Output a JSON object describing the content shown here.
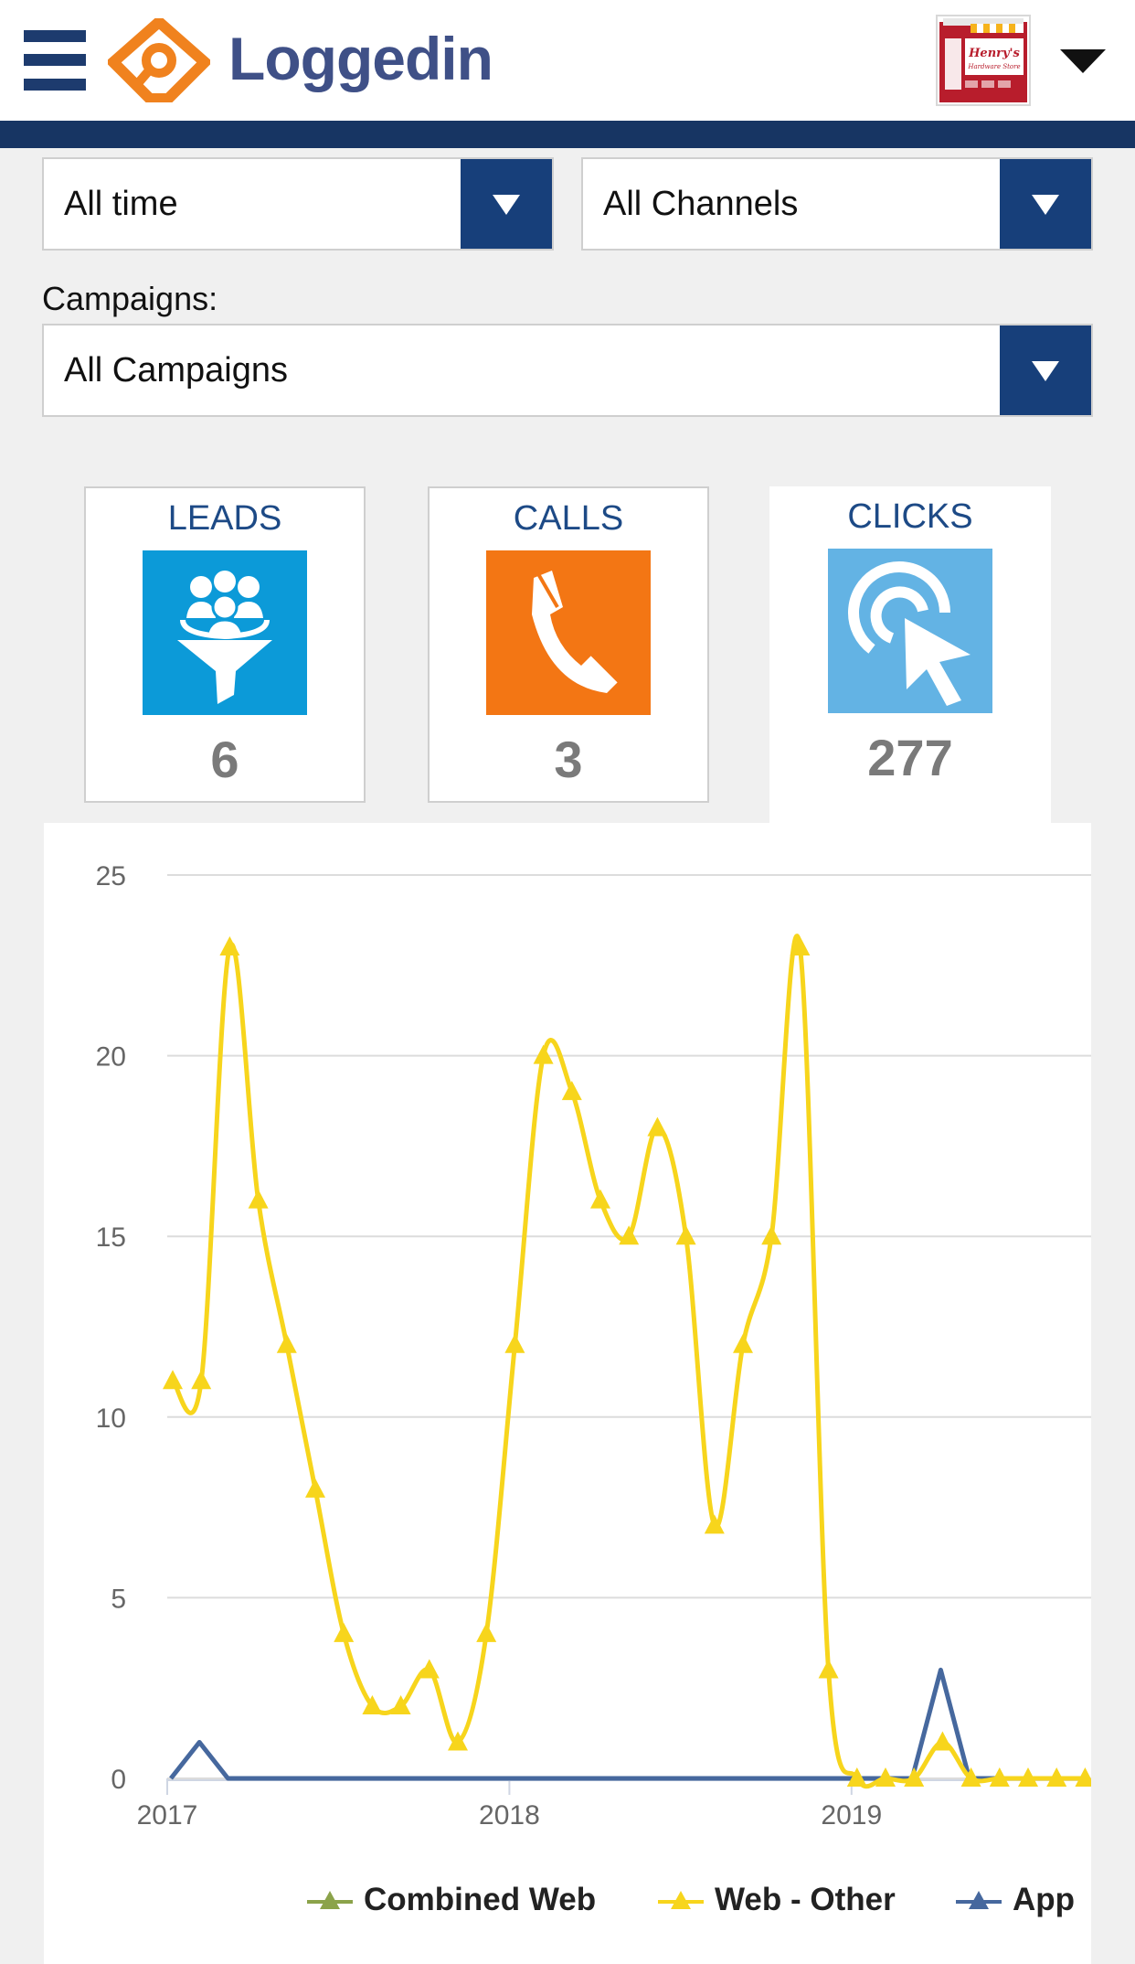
{
  "header": {
    "brand": "Loggedin",
    "store_logo_text_1": "Henry's",
    "store_logo_text_2": "Hardware Store",
    "colors": {
      "brand_navy": "#173563",
      "logo_orange": "#f0821e",
      "brand_text": "#3f5087"
    }
  },
  "filters": {
    "time_range": "All time",
    "channel": "All Channels",
    "campaigns_label": "Campaigns:",
    "campaign": "All Campaigns"
  },
  "metrics": [
    {
      "title": "LEADS",
      "count": "6",
      "icon": "funnel-people-icon",
      "color": "#0c9ad8"
    },
    {
      "title": "CALLS",
      "count": "3",
      "icon": "phone-icon",
      "color": "#f37614"
    },
    {
      "title": "CLICKS",
      "count": "277",
      "icon": "click-cursor-icon",
      "color": "#63b3e4",
      "selected": true
    }
  ],
  "chart_data": {
    "type": "line",
    "title": "",
    "xlabel": "",
    "ylabel": "",
    "ylim": [
      0,
      25
    ],
    "yticks": [
      "0",
      "5",
      "10",
      "15",
      "20",
      "25"
    ],
    "xticks": [
      "2017",
      "2018",
      "2019"
    ],
    "grid": true,
    "legend_position": "bottom-right",
    "x": [
      "2017-01",
      "2017-02",
      "2017-03",
      "2017-04",
      "2017-05",
      "2017-06",
      "2017-07",
      "2017-08",
      "2017-09",
      "2017-10",
      "2017-11",
      "2017-12",
      "2018-01",
      "2018-02",
      "2018-03",
      "2018-04",
      "2018-05",
      "2018-06",
      "2018-07",
      "2018-08",
      "2018-09",
      "2018-10",
      "2018-11",
      "2018-12",
      "2019-01",
      "2019-02",
      "2019-03",
      "2019-04",
      "2019-05",
      "2019-06",
      "2019-07",
      "2019-08",
      "2019-09"
    ],
    "series": [
      {
        "name": "Combined Web",
        "color": "#8ba34a",
        "values": []
      },
      {
        "name": "Web - Other",
        "color": "#f7d51c",
        "values": [
          11,
          11,
          23,
          16,
          12,
          8,
          4,
          2,
          2,
          3,
          1,
          4,
          12,
          20,
          19,
          16,
          15,
          18,
          15,
          7,
          12,
          15,
          23,
          3,
          0,
          0,
          0,
          1,
          0,
          0,
          0,
          0,
          0
        ]
      },
      {
        "name": "App",
        "color": "#46689e",
        "values": [
          0,
          1,
          0,
          0,
          0,
          0,
          0,
          0,
          0,
          0,
          0,
          0,
          0,
          0,
          0,
          0,
          0,
          0,
          0,
          0,
          0,
          0,
          0,
          0,
          0,
          0,
          0,
          3,
          0,
          0,
          0,
          0,
          0
        ]
      }
    ]
  }
}
